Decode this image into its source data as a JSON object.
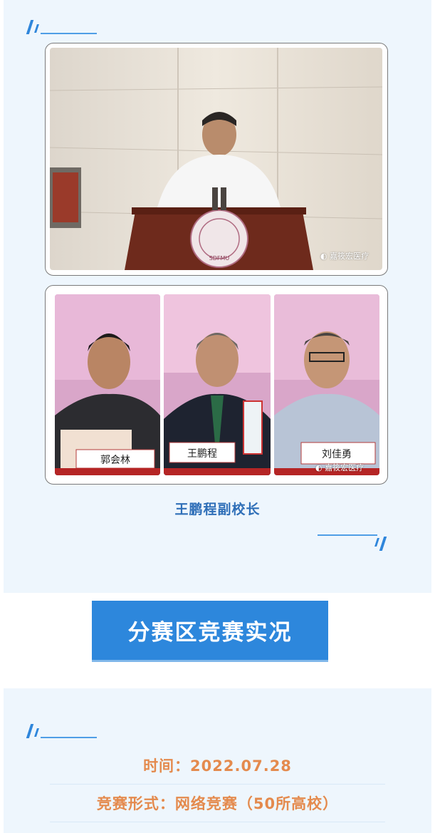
{
  "caption": "王鹏程副校长",
  "section_heading": "分赛区竞赛实况",
  "info": {
    "time": "时间：2022.07.28",
    "format": "竞赛形式：网络竞赛（50所高校）"
  },
  "photos": {
    "watermark": "嘉筱宏医疗",
    "podium_emblem_text": "SDFMU",
    "nameplates": [
      "郭会林",
      "王鹏程",
      "刘佳勇"
    ]
  },
  "colors": {
    "accent": "#2d87dc",
    "caption": "#2f6fb8",
    "info_text": "#e48a4d",
    "card_bg": "#eef6fd"
  }
}
